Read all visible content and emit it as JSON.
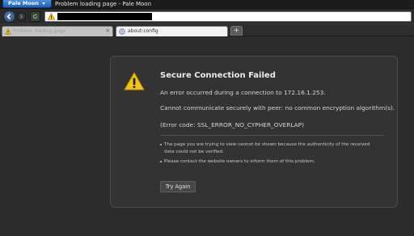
{
  "app": {
    "menu_label": "Pale Moon"
  },
  "window": {
    "title": "Problem loading page - Pale Moon"
  },
  "tabs": [
    {
      "label": "Problem loading page"
    },
    {
      "label": "about:config"
    }
  ],
  "new_tab_label": "+",
  "error": {
    "title": "Secure Connection Failed",
    "line1": "An error occurred during a connection to 172.16.1.253.",
    "line2": "Cannot communicate securely with peer: no common encryption algorithm(s).",
    "line3": "(Error code: SSL_ERROR_NO_CYPHER_OVERLAP)",
    "bullets": [
      "The page you are trying to view cannot be shown because the authenticity of the received data could not be verified.",
      "Please contact the website owners to inform them of this problem."
    ],
    "button_label": "Try Again"
  },
  "colors": {
    "app_button": "#2f76d2",
    "warning": "#f2c318",
    "panel": "#333333"
  }
}
